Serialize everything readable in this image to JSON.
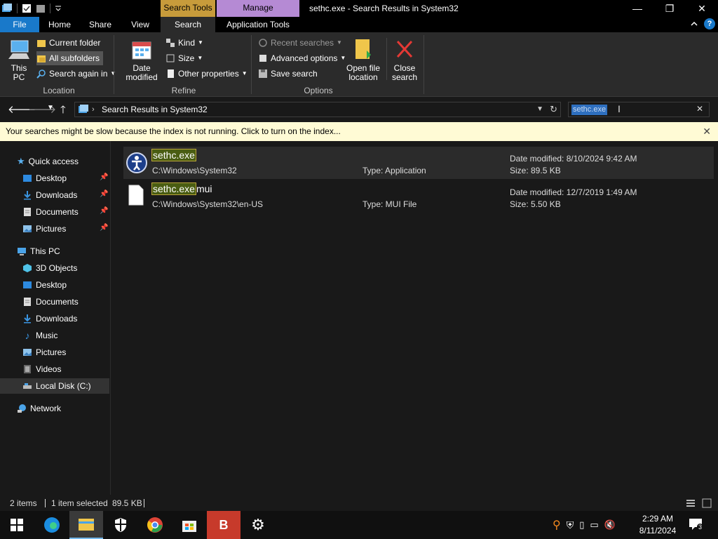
{
  "window": {
    "title": "sethc.exe - Search Results in System32",
    "context_tabs": {
      "search_tools": "Search Tools",
      "manage": "Manage"
    },
    "controls": {
      "minimize": "—",
      "maximize": "❐",
      "close": "✕"
    }
  },
  "tabs": [
    "File",
    "Home",
    "Share",
    "View",
    "Search",
    "Application Tools"
  ],
  "ribbon": {
    "location": {
      "label": "Location",
      "this_pc": "This PC",
      "current_folder": "Current folder",
      "all_subfolders": "All subfolders",
      "search_again_in": "Search again in"
    },
    "refine": {
      "label": "Refine",
      "date_modified": "Date modified",
      "kind": "Kind",
      "size": "Size",
      "other_properties": "Other properties"
    },
    "options": {
      "label": "Options",
      "recent_searches": "Recent searches",
      "advanced_options": "Advanced options",
      "save_search": "Save search",
      "open_file_location": "Open file location",
      "close_search": "Close search"
    }
  },
  "address": {
    "path": "Search Results in System32",
    "search_query": "sethc.exe"
  },
  "infobar": {
    "message": "Your searches might be slow because the index is not running.  Click to turn on the index..."
  },
  "nav": {
    "quick_access": "Quick access",
    "quick_items": [
      "Desktop",
      "Downloads",
      "Documents",
      "Pictures"
    ],
    "this_pc": "This PC",
    "pc_items": [
      "3D Objects",
      "Desktop",
      "Documents",
      "Downloads",
      "Music",
      "Pictures",
      "Videos",
      "Local Disk (C:)"
    ],
    "network": "Network"
  },
  "results": [
    {
      "name_match": "sethc.exe",
      "name_rest": "",
      "path": "C:\\Windows\\System32",
      "type": "Type: Application",
      "date": "Date modified: 8/10/2024 9:42 AM",
      "size": "Size: 89.5 KB"
    },
    {
      "name_match": "sethc.exe",
      "name_rest": "mui",
      "path": "C:\\Windows\\System32\\en-US",
      "type": "Type: MUI File",
      "date": "Date modified: 12/7/2019 1:49 AM",
      "size": "Size: 5.50 KB"
    }
  ],
  "status": {
    "items": "2 items",
    "selected": "1 item selected",
    "selected_size": "89.5 KB"
  },
  "taskbar": {
    "time": "2:29 AM",
    "date": "8/11/2024",
    "notifications": "3"
  },
  "colors": {
    "accent": "#1979ca",
    "search_tools": "#c79b3b",
    "manage": "#b58ad4",
    "infobar": "#fffbd5"
  }
}
